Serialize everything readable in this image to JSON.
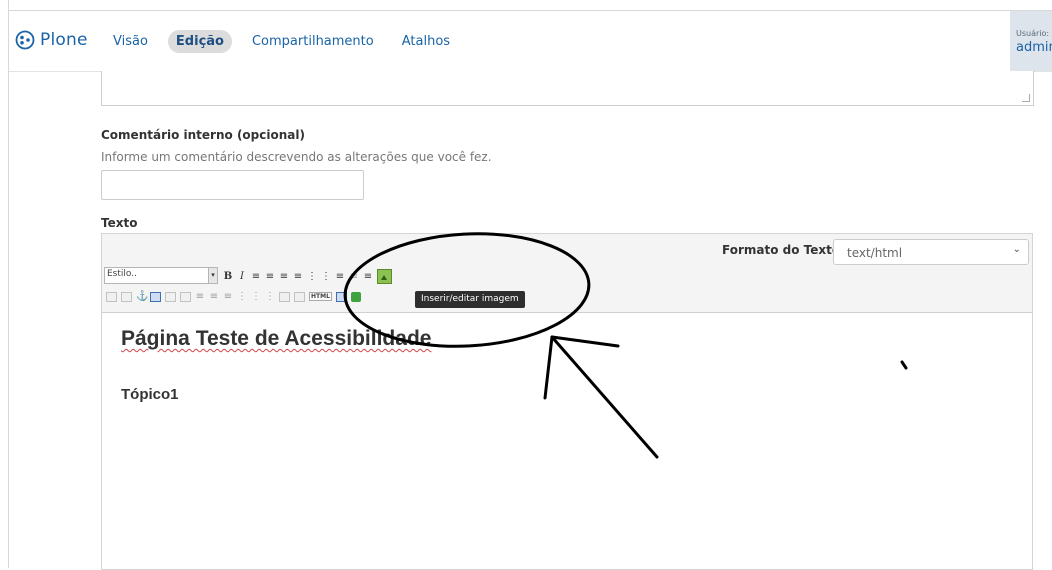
{
  "toolbar": {
    "brand": "Plone",
    "nav": [
      {
        "label": "Visão",
        "active": false
      },
      {
        "label": "Edição",
        "active": true
      },
      {
        "label": "Compartilhamento",
        "active": false
      },
      {
        "label": "Atalhos",
        "active": false
      }
    ],
    "user_label": "Usuário:",
    "user_name": "admin"
  },
  "form": {
    "comment_label": "Comentário interno (opcional)",
    "comment_help": "Informe um comentário descrevendo as alterações que você fez.",
    "comment_value": "",
    "text_label": "Texto"
  },
  "editor": {
    "format_label": "Formato do Texto",
    "format_value": "text/html",
    "style_value": "Estilo..",
    "tooltip": "Inserir/editar imagem",
    "html_button": "HTML",
    "content_heading": "Página Teste de Acessibilidade",
    "content_subheading": "Tópico1"
  },
  "colors": {
    "brand": "#1a63a6",
    "active_tab_bg": "#dcdcdc",
    "annotation": "#000000"
  },
  "icons": {
    "logo": "plone-logo-icon",
    "insert_image": "insert-image-icon"
  }
}
